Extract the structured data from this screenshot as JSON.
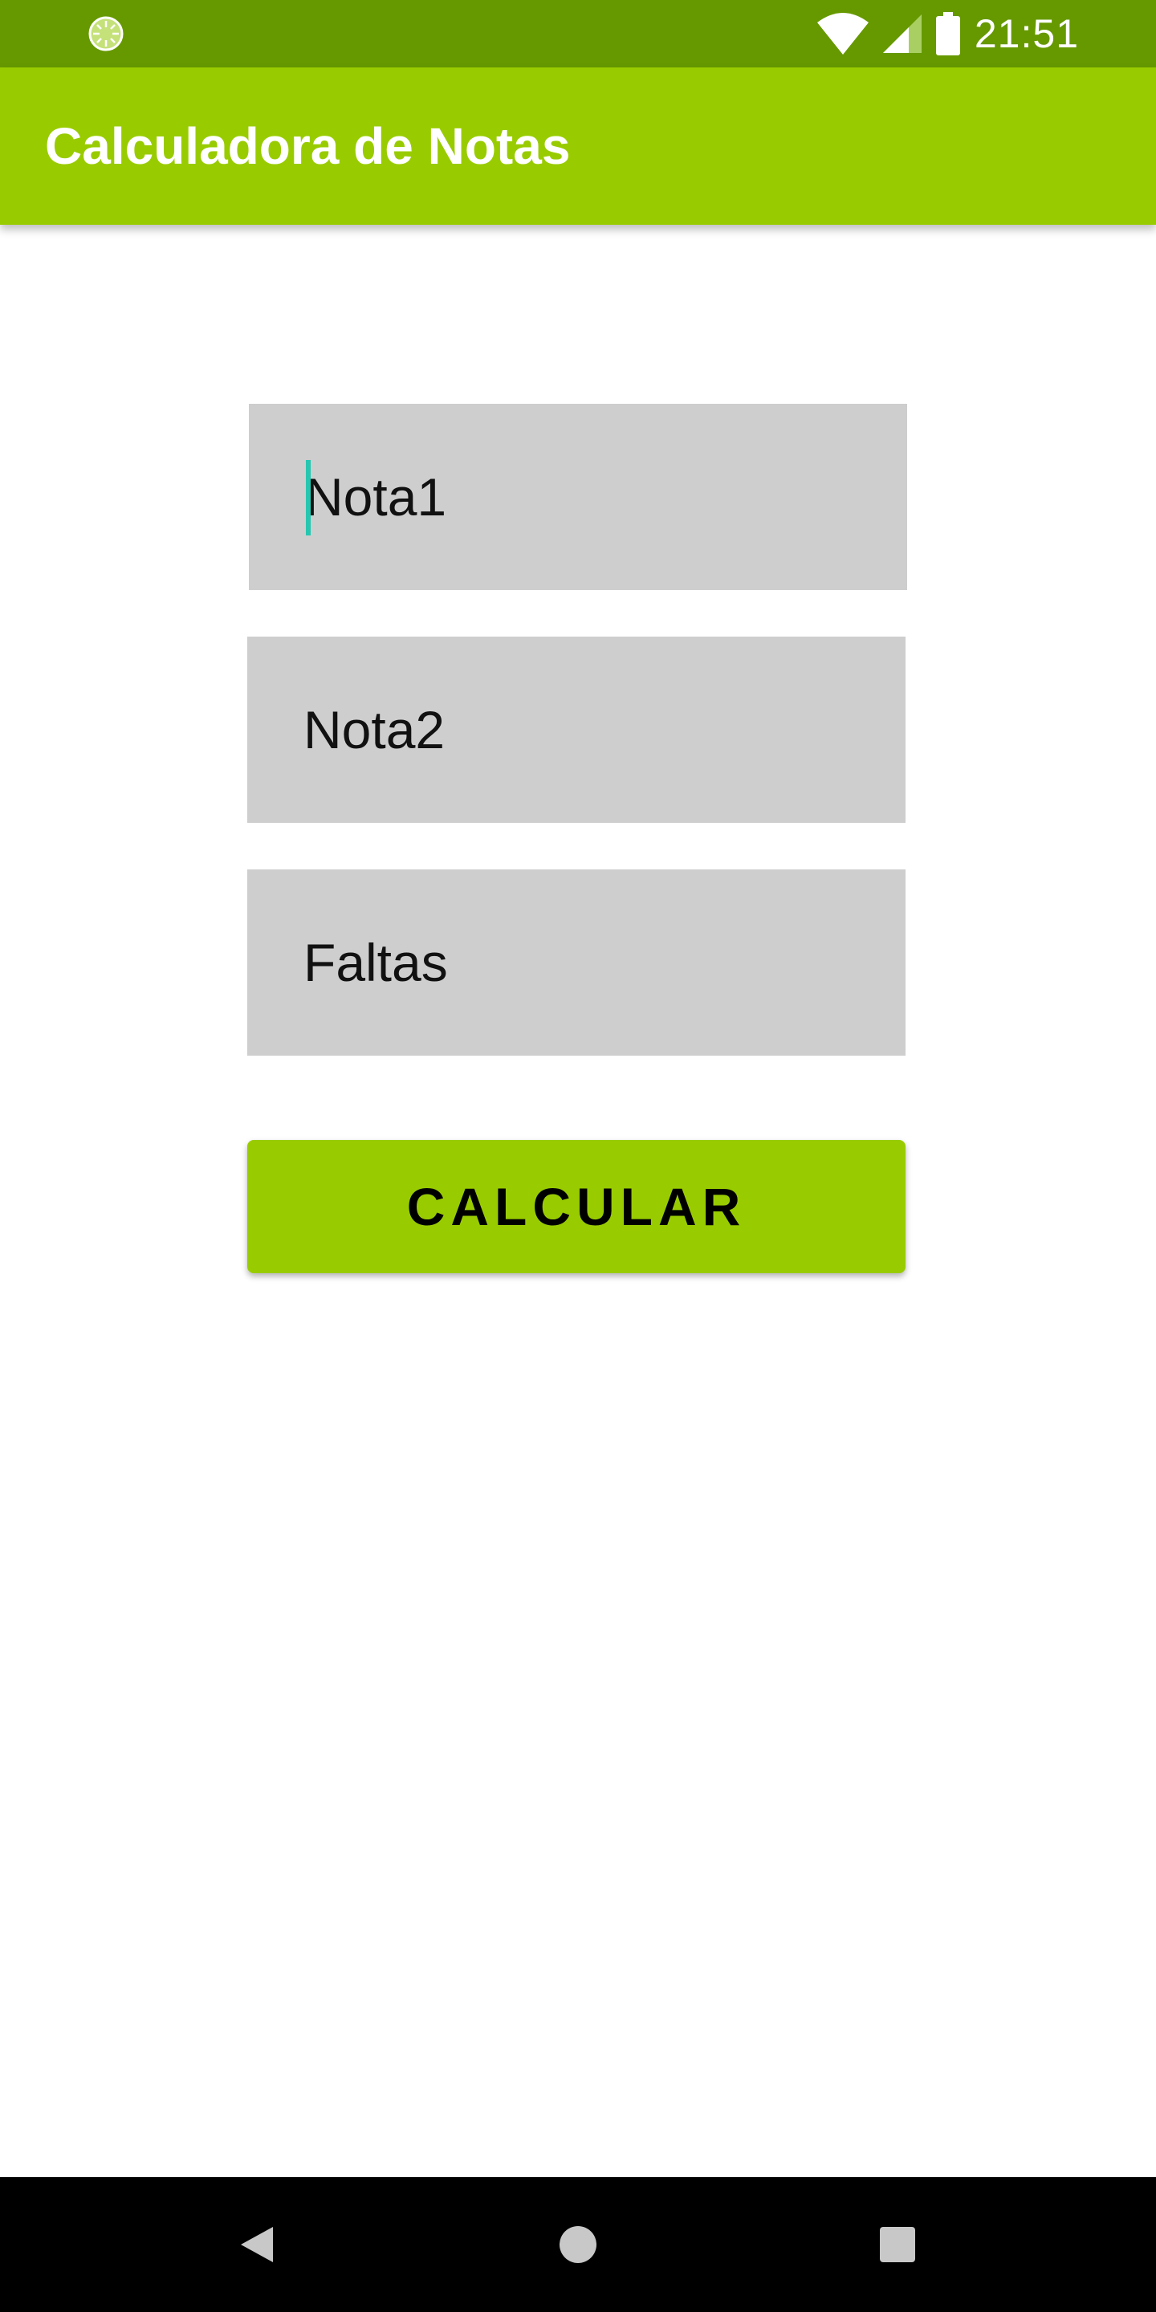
{
  "status_bar": {
    "time": "21:51",
    "icons": [
      "loading-icon",
      "wifi-icon",
      "signal-icon",
      "battery-icon"
    ]
  },
  "app_bar": {
    "title": "Calculadora de Notas"
  },
  "form": {
    "nota1_placeholder": "Nota1",
    "nota2_placeholder": "Nota2",
    "faltas_placeholder": "Faltas",
    "calc_button_label": "CALCULAR"
  },
  "nav_bar": {
    "icons": [
      "back-icon",
      "home-icon",
      "recents-icon"
    ]
  },
  "colors": {
    "status_bar": "#669900",
    "app_bar": "#99cc00",
    "button": "#99cc00",
    "field_background": "#cecece",
    "cursor": "#26c6b0"
  }
}
